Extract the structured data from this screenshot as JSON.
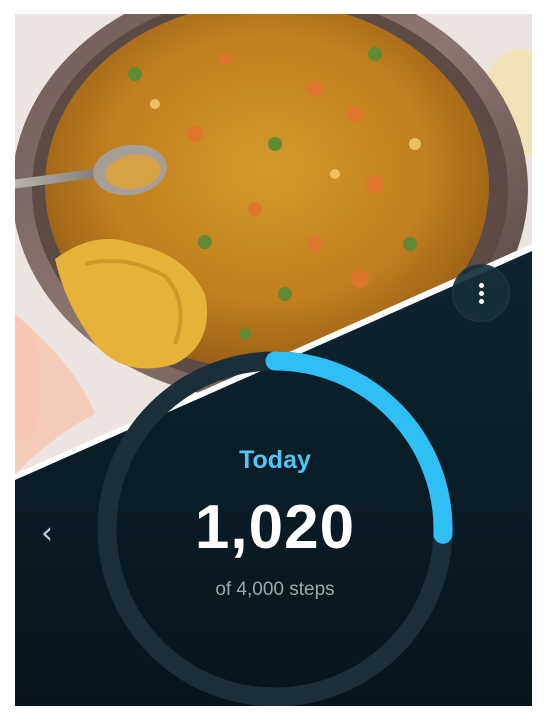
{
  "activity": {
    "period_label": "Today",
    "steps": "1,020",
    "goal_text": "of 4,000 steps",
    "progress_fraction": 0.255
  },
  "controls": {
    "more_icon": "more-vert-icon",
    "back_icon": "chevron-left-icon",
    "back_glyph": "‹"
  },
  "colors": {
    "panel_bg": "#0b1c26",
    "accent": "#2fbff5",
    "ring_track": "#1c2e38",
    "label": "#4fc6f5"
  }
}
